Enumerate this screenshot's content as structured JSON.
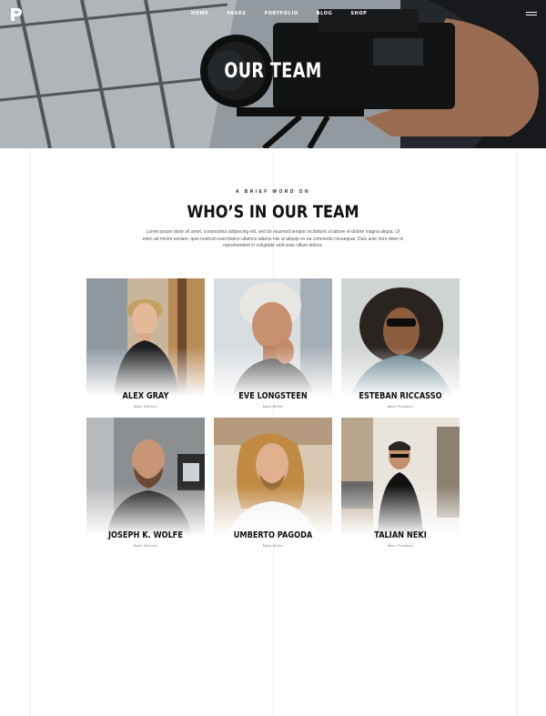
{
  "nav": {
    "logo_letter": "P",
    "items": [
      {
        "label": "HOME"
      },
      {
        "label": "PAGES"
      },
      {
        "label": "PORTFOLIO"
      },
      {
        "label": "BLOG"
      },
      {
        "label": "SHOP"
      }
    ]
  },
  "hero": {
    "title": "OUR TEAM"
  },
  "intro": {
    "eyebrow": "A BRIEF WORD ON",
    "heading": "WHO’S IN OUR TEAM",
    "paragraph": "Lorem ipsum dolor sit amet, consectetur adipiscing elit, sed do eiusmod tempor incididunt ut labore et dolore magna aliqua. Ut enim ad minim veniam, quis nostrud exercitation ullamco laboris nisi ut aliquip ex ea commodo consequat. Duis aute irure dolor in reprehenderit in voluptate velit esse cillum dolore."
  },
  "team": [
    {
      "name": "ALEX GRAY",
      "role": "Main Director"
    },
    {
      "name": "EVE LONGSTEEN",
      "role": "Main Writer"
    },
    {
      "name": "ESTEBAN RICCASSO",
      "role": "Main Producer"
    },
    {
      "name": "JOSEPH K. WOLFE",
      "role": "Main Director"
    },
    {
      "name": "UMBERTO PAGODA",
      "role": "Main Writer"
    },
    {
      "name": "TALIAN NEKI",
      "role": "Main Producer"
    }
  ],
  "colors": {
    "accent_text": "#111111",
    "hero_overlay": "#5d6468"
  }
}
